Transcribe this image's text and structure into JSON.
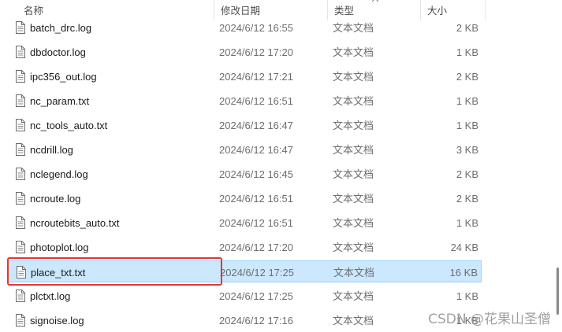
{
  "columns": {
    "name": "名称",
    "date": "修改日期",
    "type": "类型",
    "size": "大小"
  },
  "files": [
    {
      "name": "batch_drc.log",
      "date": "2024/6/12 16:55",
      "type": "文本文档",
      "size": "2 KB",
      "selected": false
    },
    {
      "name": "dbdoctor.log",
      "date": "2024/6/12 17:20",
      "type": "文本文档",
      "size": "1 KB",
      "selected": false
    },
    {
      "name": "ipc356_out.log",
      "date": "2024/6/12 17:21",
      "type": "文本文档",
      "size": "2 KB",
      "selected": false
    },
    {
      "name": "nc_param.txt",
      "date": "2024/6/12 16:51",
      "type": "文本文档",
      "size": "1 KB",
      "selected": false
    },
    {
      "name": "nc_tools_auto.txt",
      "date": "2024/6/12 16:47",
      "type": "文本文档",
      "size": "1 KB",
      "selected": false
    },
    {
      "name": "ncdrill.log",
      "date": "2024/6/12 16:47",
      "type": "文本文档",
      "size": "3 KB",
      "selected": false
    },
    {
      "name": "nclegend.log",
      "date": "2024/6/12 16:45",
      "type": "文本文档",
      "size": "2 KB",
      "selected": false
    },
    {
      "name": "ncroute.log",
      "date": "2024/6/12 16:51",
      "type": "文本文档",
      "size": "2 KB",
      "selected": false
    },
    {
      "name": "ncroutebits_auto.txt",
      "date": "2024/6/12 16:51",
      "type": "文本文档",
      "size": "1 KB",
      "selected": false
    },
    {
      "name": "photoplot.log",
      "date": "2024/6/12 17:20",
      "type": "文本文档",
      "size": "24 KB",
      "selected": false
    },
    {
      "name": "place_txt.txt",
      "date": "2024/6/12 17:25",
      "type": "文本文档",
      "size": "16 KB",
      "selected": true
    },
    {
      "name": "plctxt.log",
      "date": "2024/6/12 17:25",
      "type": "文本文档",
      "size": "1 KB",
      "selected": false
    },
    {
      "name": "signoise.log",
      "date": "2024/6/12 17:16",
      "type": "文本文档",
      "size": "1 KB",
      "selected": false
    }
  ],
  "icons": {
    "file": "text-file-icon",
    "sort": "sort-up-icon"
  },
  "colors": {
    "selection_bg": "#cce8ff",
    "selection_border": "#99d1ff",
    "highlight_box": "#e8352c"
  },
  "watermark": "CSDN @花果山圣僧"
}
